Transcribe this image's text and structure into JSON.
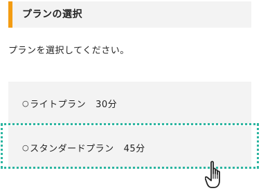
{
  "header": {
    "title": "プランの選択",
    "accent_color": "#f39c12"
  },
  "instruction": "プランを選択してください。",
  "plans": [
    {
      "radio": "○",
      "name": "ライトプラン",
      "duration": "30分"
    },
    {
      "radio": "○",
      "name": "スタンダードプラン",
      "duration": "45分"
    }
  ],
  "highlight": {
    "color": "#2bb5a0",
    "target": "plans.1"
  },
  "cursor": {
    "icon": "hand-pointer-icon"
  }
}
